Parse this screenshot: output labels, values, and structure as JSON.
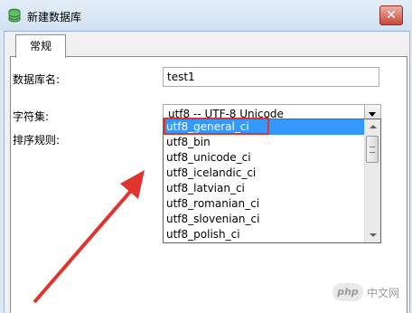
{
  "window": {
    "title": "新建数据库",
    "icon": "database-icon",
    "close_glyph": "✕"
  },
  "tabs": [
    {
      "label": "常规"
    }
  ],
  "form": {
    "db_name": {
      "label": "数据库名:",
      "value": "test1"
    },
    "charset": {
      "label": "字符集:",
      "value": "utf8 -- UTF-8 Unicode"
    },
    "collation": {
      "label": "排序规则:",
      "value": "utf8_general_ci",
      "options": [
        "utf8_general_ci",
        "utf8_bin",
        "utf8_unicode_ci",
        "utf8_icelandic_ci",
        "utf8_latvian_ci",
        "utf8_romanian_ci",
        "utf8_slovenian_ci",
        "utf8_polish_ci"
      ]
    }
  },
  "annotation": {
    "box_color": "#e0342c",
    "arrow_color": "#e0342c"
  },
  "watermark": {
    "logo": "php",
    "text": "中文网"
  }
}
